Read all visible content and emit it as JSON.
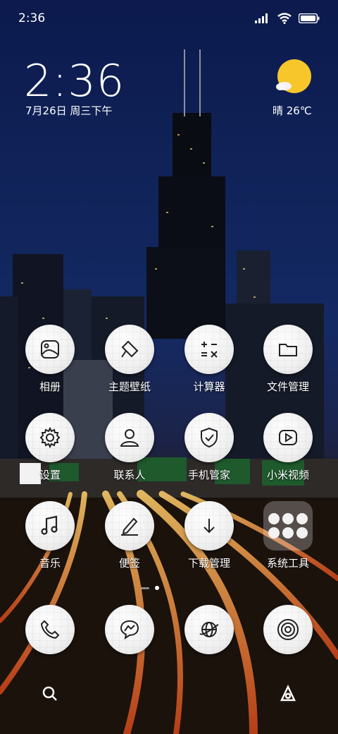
{
  "status_bar": {
    "time": "2:36"
  },
  "clock_widget": {
    "time": "2:36",
    "date": "7月26日 周三下午"
  },
  "weather_widget": {
    "text": "晴 26℃"
  },
  "apps": [
    {
      "label": "相册",
      "icon": "gallery-icon"
    },
    {
      "label": "主题壁纸",
      "icon": "themes-icon"
    },
    {
      "label": "计算器",
      "icon": "calculator-icon"
    },
    {
      "label": "文件管理",
      "icon": "folder-icon"
    },
    {
      "label": "设置",
      "icon": "gear-icon"
    },
    {
      "label": "联系人",
      "icon": "contacts-icon"
    },
    {
      "label": "手机管家",
      "icon": "shield-icon"
    },
    {
      "label": "小米视频",
      "icon": "video-icon"
    },
    {
      "label": "音乐",
      "icon": "music-icon"
    },
    {
      "label": "便签",
      "icon": "notes-icon"
    },
    {
      "label": "下载管理",
      "icon": "download-icon"
    },
    {
      "label": "系统工具",
      "icon": "tools-folder-icon"
    }
  ],
  "dock": [
    {
      "icon": "phone-icon"
    },
    {
      "icon": "messages-icon"
    },
    {
      "icon": "browser-icon"
    },
    {
      "icon": "camera-icon"
    }
  ]
}
